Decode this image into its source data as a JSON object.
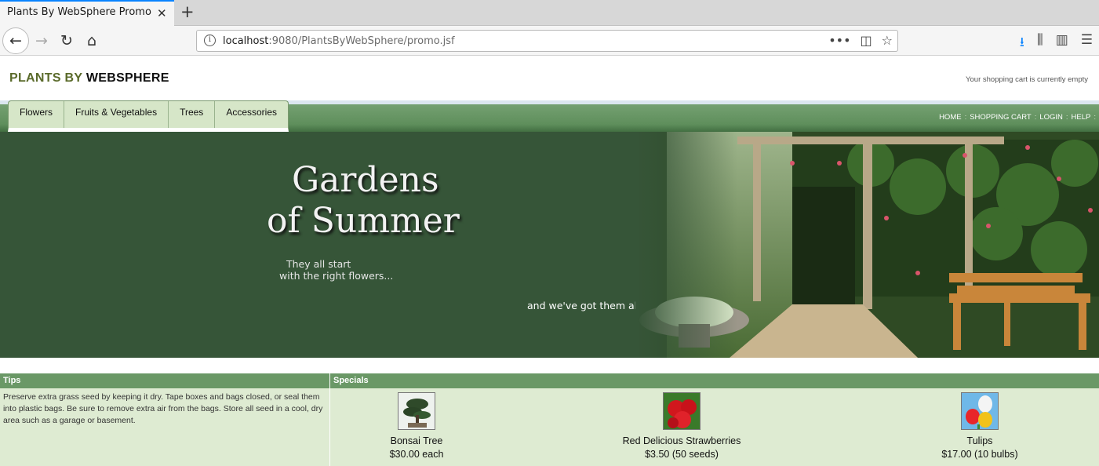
{
  "browser": {
    "tab_title": "Plants By WebSphere Promo",
    "url_host": "localhost",
    "url_rest": ":9080/PlantsByWebSphere/promo.jsf"
  },
  "header": {
    "logo_part1": "PLANTS BY",
    "logo_part2": "WEBSPHERE",
    "cart_status": "Your shopping cart is currently empty"
  },
  "nav": {
    "tabs": [
      "Flowers",
      "Fruits & Vegetables",
      "Trees",
      "Accessories"
    ],
    "links": [
      "HOME",
      "SHOPPING CART",
      "LOGIN",
      "HELP"
    ]
  },
  "banner": {
    "title_line1": "Gardens",
    "title_line2": "of Summer",
    "sub_line1": "They all start",
    "sub_line2": "with the right flowers...",
    "tagline": "and we've got them all"
  },
  "tips": {
    "heading": "Tips",
    "text": "Preserve extra grass seed by keeping it dry. Tape boxes and bags closed, or seal them into plastic bags. Be sure to remove extra air from the bags. Store all seed in a cool, dry area such as a garage or basement."
  },
  "specials": {
    "heading": "Specials",
    "items": [
      {
        "name": "Bonsai Tree",
        "price": "$30.00 each"
      },
      {
        "name": "Red Delicious Strawberries",
        "price": "$3.50 (50 seeds)"
      },
      {
        "name": "Tulips",
        "price": "$17.00 (10 bulbs)"
      }
    ]
  }
}
